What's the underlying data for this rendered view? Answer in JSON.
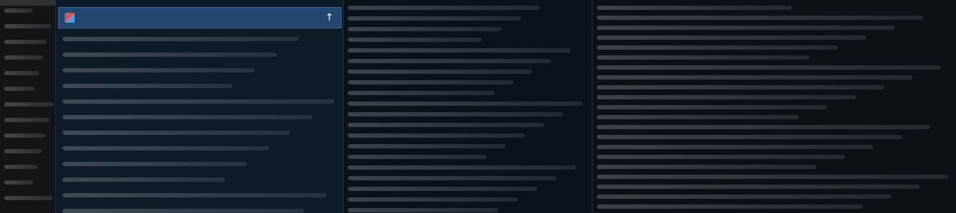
{
  "sidebar": {
    "items": [
      {
        "label": ""
      },
      {
        "label": ""
      },
      {
        "label": ""
      },
      {
        "label": ""
      },
      {
        "label": ""
      },
      {
        "label": ""
      },
      {
        "label": ""
      },
      {
        "label": ""
      },
      {
        "label": ""
      },
      {
        "label": ""
      },
      {
        "label": ""
      },
      {
        "label": ""
      },
      {
        "label": ""
      }
    ]
  },
  "panel1": {
    "header": {
      "title": "",
      "arrow": "↑",
      "icon": "app-icon"
    },
    "lines": [
      "",
      "",
      "",
      "",
      "",
      "",
      "",
      "",
      "",
      "",
      "",
      ""
    ]
  },
  "panel2": {
    "lines": [
      "",
      "",
      "",
      "",
      "",
      "",
      "",
      "",
      "",
      "",
      "",
      "",
      "",
      "",
      "",
      "",
      "",
      "",
      "",
      ""
    ]
  },
  "panel3": {
    "lines": [
      "",
      "",
      "",
      "",
      "",
      "",
      "",
      "",
      "",
      "",
      "",
      "",
      "",
      "",
      "",
      "",
      "",
      "",
      "",
      "",
      "",
      ""
    ]
  },
  "colors": {
    "header_bg": "#23466f",
    "panel_bg": "#0d1a27",
    "page_bg": "#0c131a"
  }
}
